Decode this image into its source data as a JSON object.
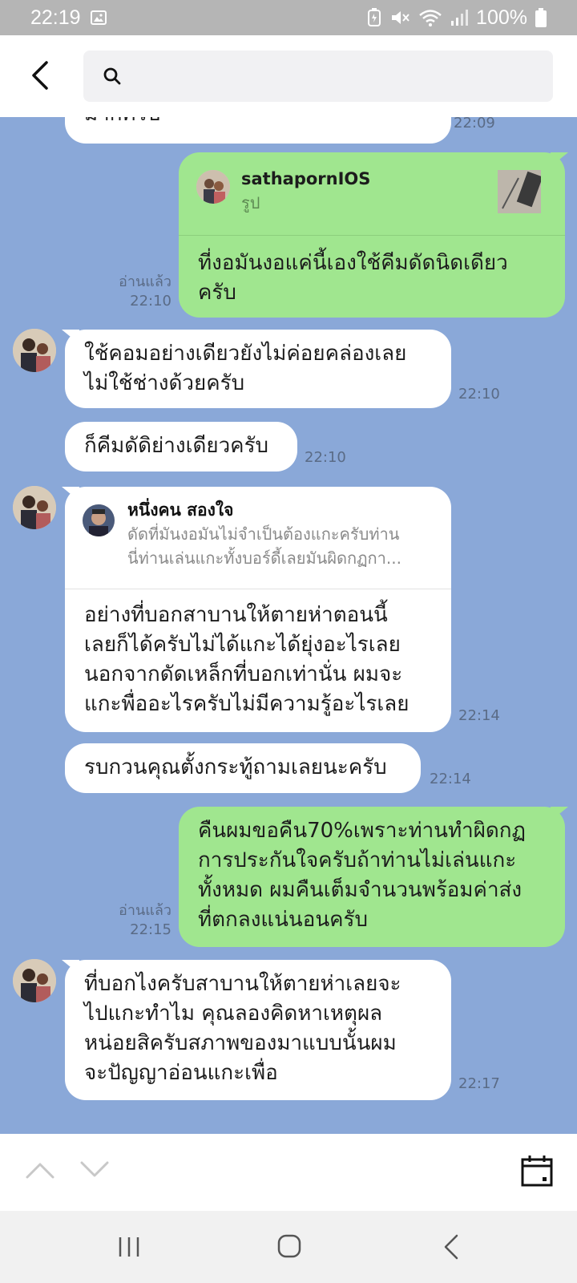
{
  "status_bar": {
    "time": "22:19",
    "battery_percent": "100%",
    "icons": [
      "image-icon",
      "battery-saver-icon",
      "mute-icon",
      "wifi-icon",
      "signal-icon",
      "battery-icon"
    ]
  },
  "header": {
    "back_icon": "back-arrow-icon",
    "search_placeholder": "",
    "search_icon": "search-icon"
  },
  "messages": [
    {
      "id": "m0",
      "side": "in",
      "text": "มากครับ",
      "time": "22:09"
    },
    {
      "id": "m1",
      "side": "out",
      "reply": {
        "name": "sathapornIOS",
        "snippet": "รูป"
      },
      "text_lines": [
        "ที่งอมันงอแค่นี้เองใช้คีมดัดนิดเดียว",
        "ครับ"
      ],
      "read": "อ่านแล้ว",
      "time": "22:10"
    },
    {
      "id": "m2",
      "side": "in",
      "text_lines": [
        "ใช้คอมอย่างเดียวยังไม่ค่อยคล่องเลย",
        "ไม่ใช้ช่างด้วยครับ"
      ],
      "time": "22:10"
    },
    {
      "id": "m3",
      "side": "in",
      "text_lines": [
        "ก็คีมดัดิย่างเดียวครับ"
      ],
      "time": "22:10"
    },
    {
      "id": "m4",
      "side": "in",
      "reply": {
        "name": "หนึ่งคน สองใจ",
        "snippet_lines": [
          "ดัดที่มันงอมันไม่จำเป็นต้องแกะครับท่าน",
          "นี่ท่านเล่นแกะทั้งบอร์ดี้เลยมันผิดกฏกา..."
        ]
      },
      "text_lines": [
        "อย่างที่บอกสาบานให้ตายห่าตอนนี้",
        "เลยก็ได้ครับไม่ได้แกะได้ยุ่งอะไรเลย",
        "นอกจากดัดเหล็กที่บอกเท่านั่น ผมจะ",
        "แกะพื่ออะไรครับไม่มีความรู้อะไรเลย"
      ],
      "time": "22:14"
    },
    {
      "id": "m5",
      "side": "in",
      "text_lines": [
        "รบกวนคุณตั้งกระทู้ถามเลยนะครับ"
      ],
      "time": "22:14"
    },
    {
      "id": "m6",
      "side": "out",
      "text_lines": [
        "คืนผมขอคืน70%เพราะท่านทำผิดกฏ",
        "การประกันใจครับถ้าท่านไม่เล่นแกะ",
        "ทั้งหมด ผมคืนเต็มจำนวนพร้อมค่าส่ง",
        "ที่ตกลงแน่นอนครับ"
      ],
      "read": "อ่านแล้ว",
      "time": "22:15"
    },
    {
      "id": "m7",
      "side": "in",
      "text_lines": [
        "ที่บอกไงครับสาบานให้ตายห่าเลยจะ",
        "ไปแกะทำไม คุณลองคิดหาเหตุผล",
        "หน่อยสิครับสภาพของมาแบบนั้นผม",
        "จะปัญญาอ่อนแกะเพื่อ"
      ],
      "time": "22:17"
    }
  ],
  "toolbar": {
    "icons": [
      "chevron-up-icon",
      "chevron-down-icon",
      "calendar-icon"
    ]
  },
  "navbar": {
    "icons": [
      "recent-apps-icon",
      "home-icon",
      "nav-back-icon"
    ]
  },
  "colors": {
    "chat_background": "#8aa8d8",
    "incoming_bubble": "#ffffff",
    "outgoing_bubble": "#a0e68f",
    "status_bar": "#b5b5b5"
  }
}
